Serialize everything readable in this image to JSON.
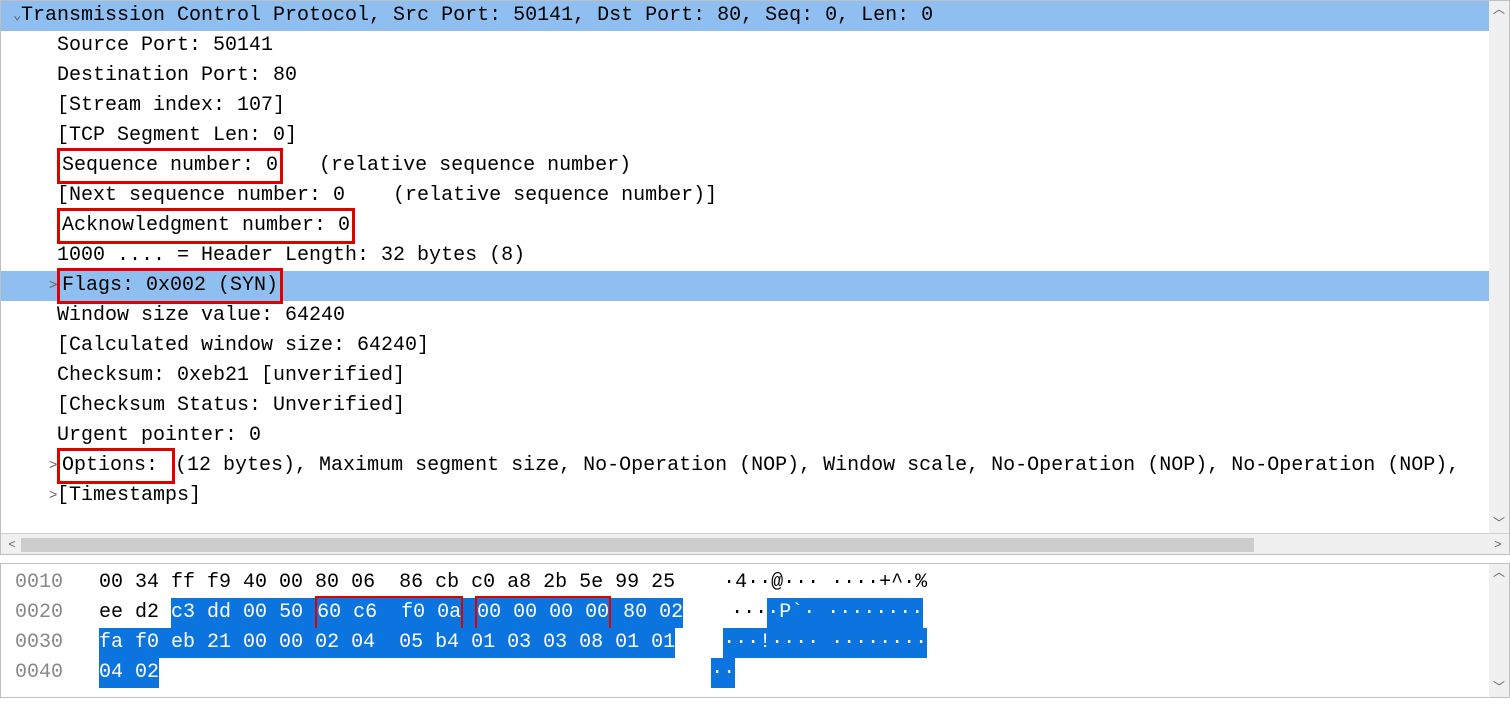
{
  "top": {
    "header": "Transmission Control Protocol, Src Port: 50141, Dst Port: 80, Seq: 0, Len: 0",
    "srcport": "Source Port: 50141",
    "dstport": "Destination Port: 80",
    "stream": "[Stream index: 107]",
    "seglen": "[TCP Segment Len: 0]",
    "seq_box": "Sequence number: 0",
    "seq_tail": "   (relative sequence number)",
    "nextseq": "[Next sequence number: 0    (relative sequence number)]",
    "ack_box": "Acknowledgment number: 0",
    "hdrlen": "1000 .... = Header Length: 32 bytes (8)",
    "flags": "Flags: 0x002 (SYN)",
    "winsize": "Window size value: 64240",
    "calcwin": "[Calculated window size: 64240]",
    "checksum": "Checksum: 0xeb21 [unverified]",
    "chkstat": "[Checksum Status: Unverified]",
    "urgent": "Urgent pointer: 0",
    "opt_box": "Options: ",
    "opt_tail": "(12 bytes), Maximum segment size, No-Operation (NOP), Window scale, No-Operation (NOP), No-Operation (NOP),",
    "timestamps": "[Timestamps]"
  },
  "hex": {
    "r1": {
      "off": "0010",
      "bytes": "   00 34 ff f9 40 00 80 06  86 cb c0 a8 2b 5e 99 25",
      "ascii": "    ·4··@··· ····+^·%"
    },
    "r2": {
      "off": "0020",
      "pre": "   ee d2 ",
      "sel1": "c3 dd 00 50 ",
      "box1": "60 c6  f0 0a",
      "gap": " ",
      "box2": "00 00 00 00",
      "sel2": " 80 02",
      "apre": "    ···",
      "asel": "·P`· ········"
    },
    "r3": {
      "off": "0030",
      "pre": "   ",
      "sel": "fa f0 eb 21 00 00 02 04  05 b4 01 03 03 08 01 01",
      "apre": "    ",
      "asel": "···!···· ········"
    },
    "r4": {
      "off": "0040",
      "pre": "   ",
      "sel": "04 02",
      "apre": "                                              ",
      "asel": "··"
    }
  }
}
